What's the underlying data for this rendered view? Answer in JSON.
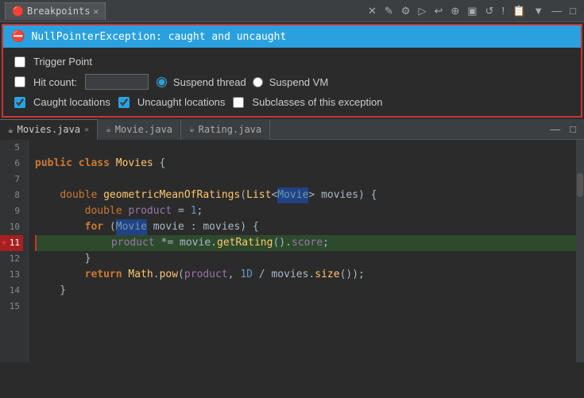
{
  "toolbar": {
    "tab_label": "Breakpoints",
    "icons": [
      "✕",
      "✎",
      "⚙",
      "▷",
      "↩",
      "⊕",
      "▣",
      "↺",
      "!",
      "📋",
      "▼",
      "—",
      "□"
    ]
  },
  "breakpoints": {
    "exception_label": "NullPointerException: caught and uncaught",
    "trigger_point_label": "Trigger Point",
    "hit_count_label": "Hit count:",
    "hit_count_value": "",
    "suspend_thread_label": "Suspend thread",
    "suspend_vm_label": "Suspend VM",
    "caught_label": "Caught locations",
    "uncaught_label": "Uncaught locations",
    "subclasses_label": "Subclasses of this exception",
    "suspend_thread_checked": true,
    "suspend_vm_checked": false,
    "caught_checked": true,
    "uncaught_checked": true,
    "subclasses_checked": false,
    "trigger_checked": false,
    "hit_count_enabled": false
  },
  "editor": {
    "tabs": [
      {
        "label": "Movies.java",
        "active": true,
        "closeable": true,
        "icon": "☕"
      },
      {
        "label": "Movie.java",
        "active": false,
        "closeable": false,
        "icon": "☕"
      },
      {
        "label": "Rating.java",
        "active": false,
        "closeable": false,
        "icon": "☕"
      }
    ],
    "lines": [
      {
        "num": 5,
        "content": ""
      },
      {
        "num": 6,
        "content": "public class Movies {"
      },
      {
        "num": 7,
        "content": ""
      },
      {
        "num": 8,
        "content": "    double geometricMeanOfRatings(List<Movie> movies) {"
      },
      {
        "num": 9,
        "content": "        double product = 1;"
      },
      {
        "num": 10,
        "content": "        for (Movie movie : movies) {"
      },
      {
        "num": 11,
        "content": "            product *= movie.getRating().score;",
        "current": true
      },
      {
        "num": 12,
        "content": "        }"
      },
      {
        "num": 13,
        "content": "        return Math.pow(product, 1D / movies.size());"
      },
      {
        "num": 14,
        "content": "    }"
      },
      {
        "num": 15,
        "content": ""
      }
    ]
  }
}
